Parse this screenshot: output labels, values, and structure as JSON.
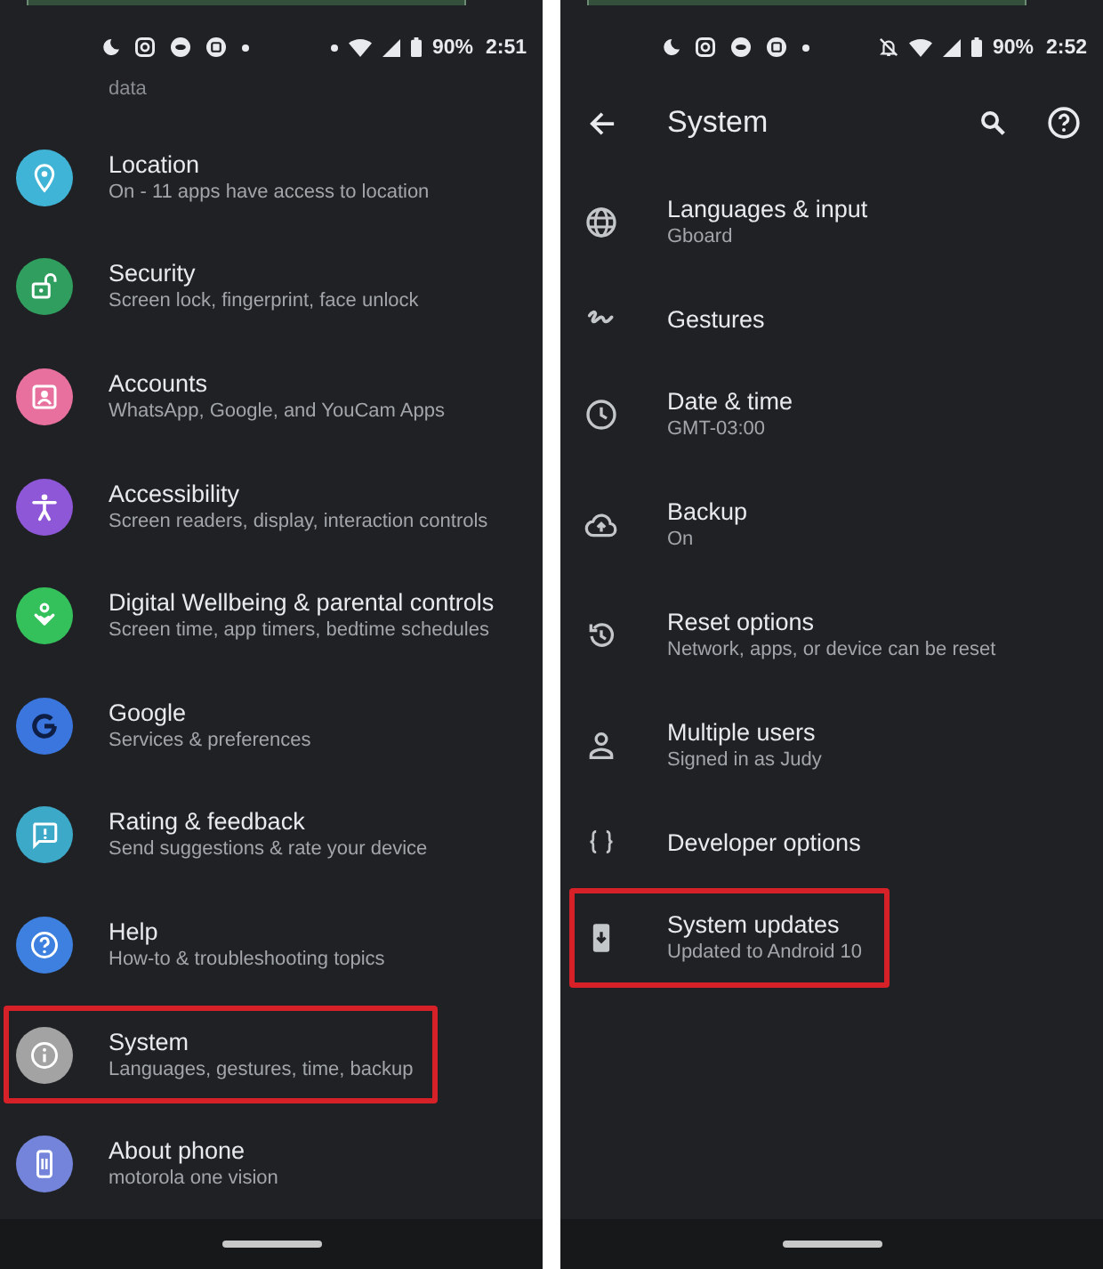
{
  "screens": [
    {
      "status_bar": {
        "notification_icons": [
          {
            "kind": "moon"
          },
          {
            "kind": "camera"
          },
          {
            "kind": "disc"
          },
          {
            "kind": "photo"
          },
          {
            "kind": "dot"
          }
        ],
        "system_icons": [
          {
            "kind": "dot"
          },
          {
            "kind": "wifi"
          },
          {
            "kind": "signal"
          },
          {
            "kind": "battery"
          }
        ],
        "battery": "90%",
        "time": "2:51"
      },
      "list": {
        "cut_off_text": "data",
        "items": [
          {
            "kind": "location",
            "color": "#40b4d6",
            "title": "Location",
            "subtitle": "On - 11 apps have access to location",
            "highlighted": false
          },
          {
            "kind": "security",
            "color": "#2f9e5e",
            "title": "Security",
            "subtitle": "Screen lock, fingerprint, face unlock",
            "highlighted": false
          },
          {
            "kind": "accounts",
            "color": "#e8709e",
            "title": "Accounts",
            "subtitle": "WhatsApp, Google, and YouCam Apps",
            "highlighted": false
          },
          {
            "kind": "accessibility",
            "color": "#8d57d8",
            "title": "Accessibility",
            "subtitle": "Screen readers, display, interaction controls",
            "highlighted": false
          },
          {
            "kind": "wellbeing",
            "color": "#34c15b",
            "title": "Digital Wellbeing & parental controls",
            "subtitle": "Screen time, app timers, bedtime schedules",
            "highlighted": false
          },
          {
            "kind": "google",
            "color": "#3a76de",
            "title": "Google",
            "subtitle": "Services & preferences",
            "highlighted": false
          },
          {
            "kind": "feedback",
            "color": "#3ca9c9",
            "title": "Rating & feedback",
            "subtitle": "Send suggestions & rate your device",
            "highlighted": false
          },
          {
            "kind": "help",
            "color": "#3d80e0",
            "title": "Help",
            "subtitle": "How-to & troubleshooting topics",
            "highlighted": false
          },
          {
            "kind": "system",
            "color": "#a3a3a3",
            "title": "System",
            "subtitle": "Languages, gestures, time, backup",
            "highlighted": true
          },
          {
            "kind": "phone",
            "color": "#7384da",
            "title": "About phone",
            "subtitle": "motorola one vision",
            "highlighted": false
          }
        ]
      }
    },
    {
      "status_bar": {
        "notification_icons": [
          {
            "kind": "moon"
          },
          {
            "kind": "camera"
          },
          {
            "kind": "disc"
          },
          {
            "kind": "photo"
          },
          {
            "kind": "dot"
          }
        ],
        "system_icons": [
          {
            "kind": "muted"
          },
          {
            "kind": "wifi"
          },
          {
            "kind": "signal"
          },
          {
            "kind": "battery"
          }
        ],
        "battery": "90%",
        "time": "2:52"
      },
      "app_bar": {
        "title": "System"
      },
      "list": {
        "items": [
          {
            "kind": "language",
            "title": "Languages & input",
            "subtitle": "Gboard",
            "highlighted": false
          },
          {
            "kind": "gestures",
            "title": "Gestures",
            "highlighted": false
          },
          {
            "kind": "clock",
            "title": "Date & time",
            "subtitle": "GMT-03:00",
            "highlighted": false
          },
          {
            "kind": "backup",
            "title": "Backup",
            "subtitle": "On",
            "highlighted": false
          },
          {
            "kind": "reset",
            "title": "Reset options",
            "subtitle": "Network, apps, or device can be reset",
            "highlighted": false
          },
          {
            "kind": "users",
            "title": "Multiple users",
            "subtitle": "Signed in as Judy",
            "highlighted": false
          },
          {
            "kind": "developer",
            "title": "Developer options",
            "highlighted": false
          },
          {
            "kind": "update",
            "title": "System updates",
            "subtitle": "Updated to Android 10",
            "highlighted": true
          }
        ]
      }
    }
  ]
}
